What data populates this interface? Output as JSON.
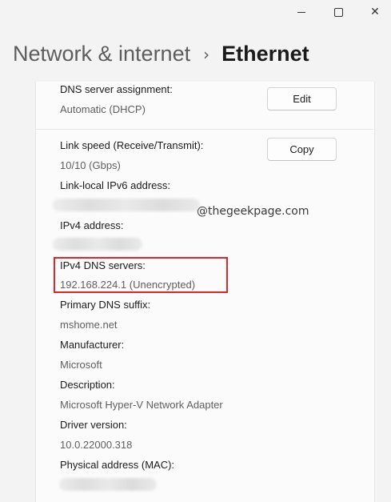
{
  "window": {
    "minimize_icon": "minimize-icon",
    "maximize_icon": "maximize-icon",
    "close_glyph": "✕"
  },
  "header": {
    "parent": "Network & internet",
    "separator": "›",
    "current": "Ethernet"
  },
  "dns_assignment": {
    "label": "DNS server assignment:",
    "value": "Automatic (DHCP)",
    "button": "Edit"
  },
  "properties": {
    "copy_button": "Copy",
    "link_speed": {
      "label": "Link speed (Receive/Transmit):",
      "value": "10/10 (Gbps)"
    },
    "ipv6": {
      "label": "Link-local IPv6 address:"
    },
    "ipv4": {
      "label": "IPv4 address:"
    },
    "dns_servers": {
      "label": "IPv4 DNS servers:",
      "value": "192.168.224.1 (Unencrypted)"
    },
    "dns_suffix": {
      "label": "Primary DNS suffix:",
      "value": "mshome.net"
    },
    "manufacturer": {
      "label": "Manufacturer:",
      "value": "Microsoft"
    },
    "description": {
      "label": "Description:",
      "value": "Microsoft Hyper-V Network Adapter"
    },
    "driver": {
      "label": "Driver version:",
      "value": "10.0.22000.318"
    },
    "mac": {
      "label": "Physical address (MAC):"
    }
  },
  "watermark": "@thegeekpage.com",
  "colors": {
    "highlight": "#e0262a",
    "background": "#f3f3f3",
    "panel": "#fbfbfb"
  }
}
